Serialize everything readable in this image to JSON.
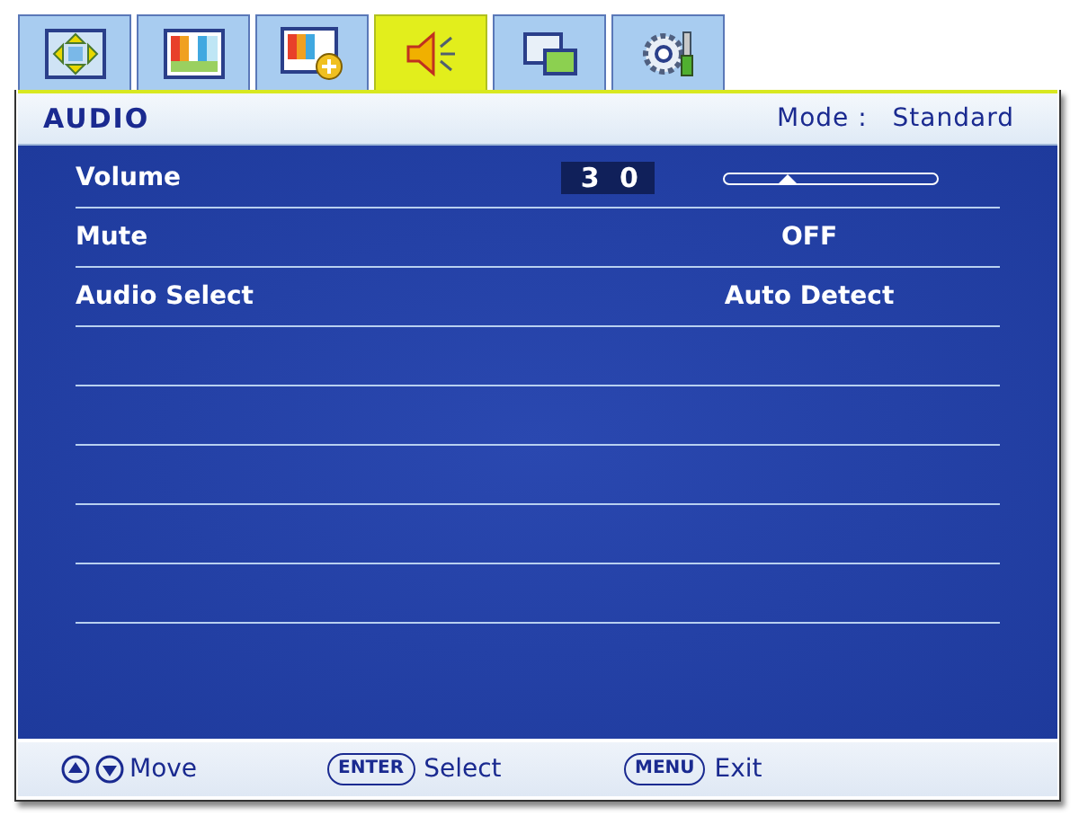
{
  "tabs": [
    {
      "selected": false
    },
    {
      "selected": false
    },
    {
      "selected": false
    },
    {
      "selected": true
    },
    {
      "selected": false
    },
    {
      "selected": false
    }
  ],
  "header": {
    "title": "AUDIO",
    "mode_label": "Mode :",
    "mode_value": "Standard"
  },
  "items": [
    {
      "kind": "slider",
      "label": "Volume",
      "value": "3 0",
      "level": 0.3
    },
    {
      "kind": "value",
      "label": "Mute",
      "value": "OFF"
    },
    {
      "kind": "value",
      "label": "Audio Select",
      "value": "Auto Detect"
    }
  ],
  "footer": [
    {
      "kind": "arrows",
      "label": "Move"
    },
    {
      "kind": "key",
      "key": "ENTER",
      "label": "Select"
    },
    {
      "kind": "key",
      "key": "MENU",
      "label": "Exit"
    }
  ]
}
